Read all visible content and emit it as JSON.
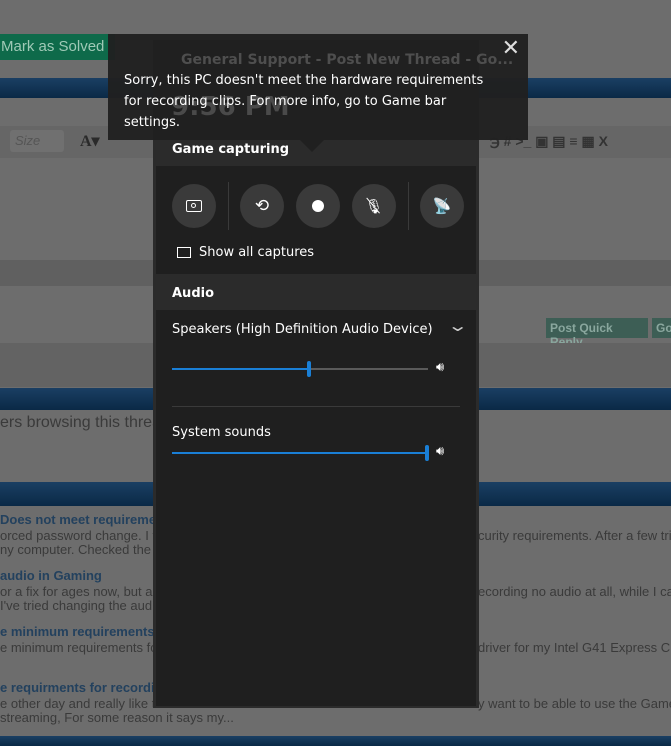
{
  "background": {
    "mark_solved": "Mark as Solved",
    "window_title": "General Support - Post New Thread - Go...",
    "clock": "9:56 PM",
    "toolbar_size": "Size",
    "post_quick_reply": "Post Quick Reply",
    "go_partial": "Go",
    "browsing": "ers browsing this thread",
    "threads": [
      {
        "title": "Does not meet requirements",
        "line1": "orced password change. I tr",
        "line1b": "curity requirements. After a few tries",
        "line2": "ny computer. Checked the lo"
      },
      {
        "title": "audio in Gaming",
        "line1": "or a fix for ages now, but all",
        "line1b": "ecording no audio at all, while I can",
        "line2": "I've tried changing the audio"
      },
      {
        "title": "e minimum requirements fo",
        "line1": "e minimum requirements fo",
        "line1b": "driver for my Intel G41 Express Chip",
        "line2": ""
      },
      {
        "title": "e requirments for recording",
        "line1": "e other day and really like th",
        "line1b": "y want to be able to use the Game",
        "line2": "streaming, For some reason it says my..."
      }
    ]
  },
  "toast": {
    "message": "Sorry, this PC doesn't meet the hardware requirements for recording clips. For more info, go to Game bar settings."
  },
  "capture": {
    "header": "Game capturing",
    "buttons": [
      "screenshot",
      "record-last",
      "record",
      "microphone-off",
      "broadcast"
    ],
    "show_all": "Show all captures"
  },
  "audio": {
    "header": "Audio",
    "device": "Speakers (High Definition Audio Device)",
    "device_volume": 0.54,
    "system_label": "System sounds",
    "system_volume": 1.0
  },
  "colors": {
    "accent": "#1a7fd6",
    "panel": "#1f1f1f",
    "header": "#2b2b2b"
  }
}
